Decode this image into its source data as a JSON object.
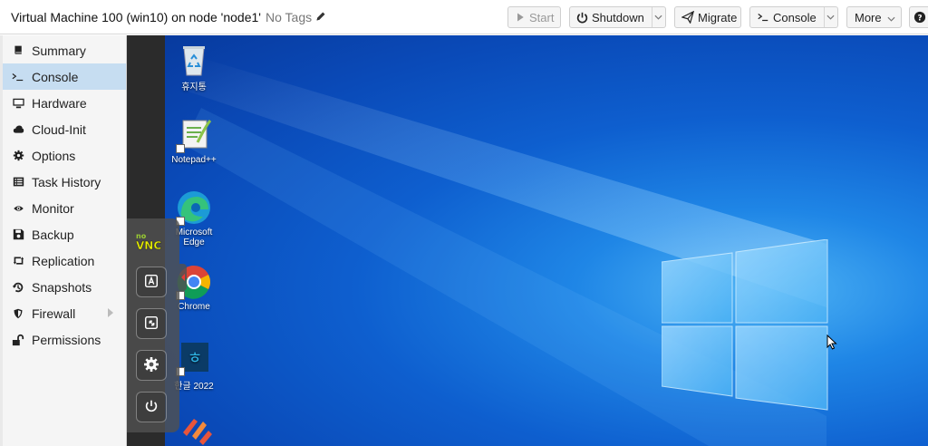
{
  "header": {
    "title": "Virtual Machine 100 (win10) on node 'node1'",
    "tags": "No Tags",
    "buttons": {
      "start": "Start",
      "shutdown": "Shutdown",
      "migrate": "Migrate",
      "console": "Console",
      "more": "More"
    }
  },
  "sidebar": {
    "items": [
      {
        "label": "Summary",
        "icon": "book-icon"
      },
      {
        "label": "Console",
        "icon": "terminal-icon",
        "active": true
      },
      {
        "label": "Hardware",
        "icon": "desktop-icon"
      },
      {
        "label": "Cloud-Init",
        "icon": "cloud-icon"
      },
      {
        "label": "Options",
        "icon": "gear-icon"
      },
      {
        "label": "Task History",
        "icon": "list-icon"
      },
      {
        "label": "Monitor",
        "icon": "eye-icon"
      },
      {
        "label": "Backup",
        "icon": "floppy-icon"
      },
      {
        "label": "Replication",
        "icon": "retweet-icon"
      },
      {
        "label": "Snapshots",
        "icon": "history-icon"
      },
      {
        "label": "Firewall",
        "icon": "shield-icon"
      },
      {
        "label": "Permissions",
        "icon": "unlock-icon"
      }
    ]
  },
  "desktop": {
    "icons": [
      {
        "label": "휴지통",
        "icon": "recycle-bin-icon"
      },
      {
        "label": "Notepad++",
        "icon": "notepad-plus-plus-icon"
      },
      {
        "label": "Microsoft Edge",
        "icon": "edge-icon"
      },
      {
        "label": "Chrome",
        "icon": "chrome-icon"
      },
      {
        "label": "한글 2022",
        "icon": "hangul-icon"
      }
    ]
  },
  "novnc": {
    "logo": "noVNC",
    "buttons": [
      "keyboard-icon",
      "fullscreen-icon",
      "settings-icon",
      "power-icon"
    ]
  },
  "colors": {
    "active_item": "#c6ddf1",
    "desktop_blue": "#0e5fcf"
  }
}
